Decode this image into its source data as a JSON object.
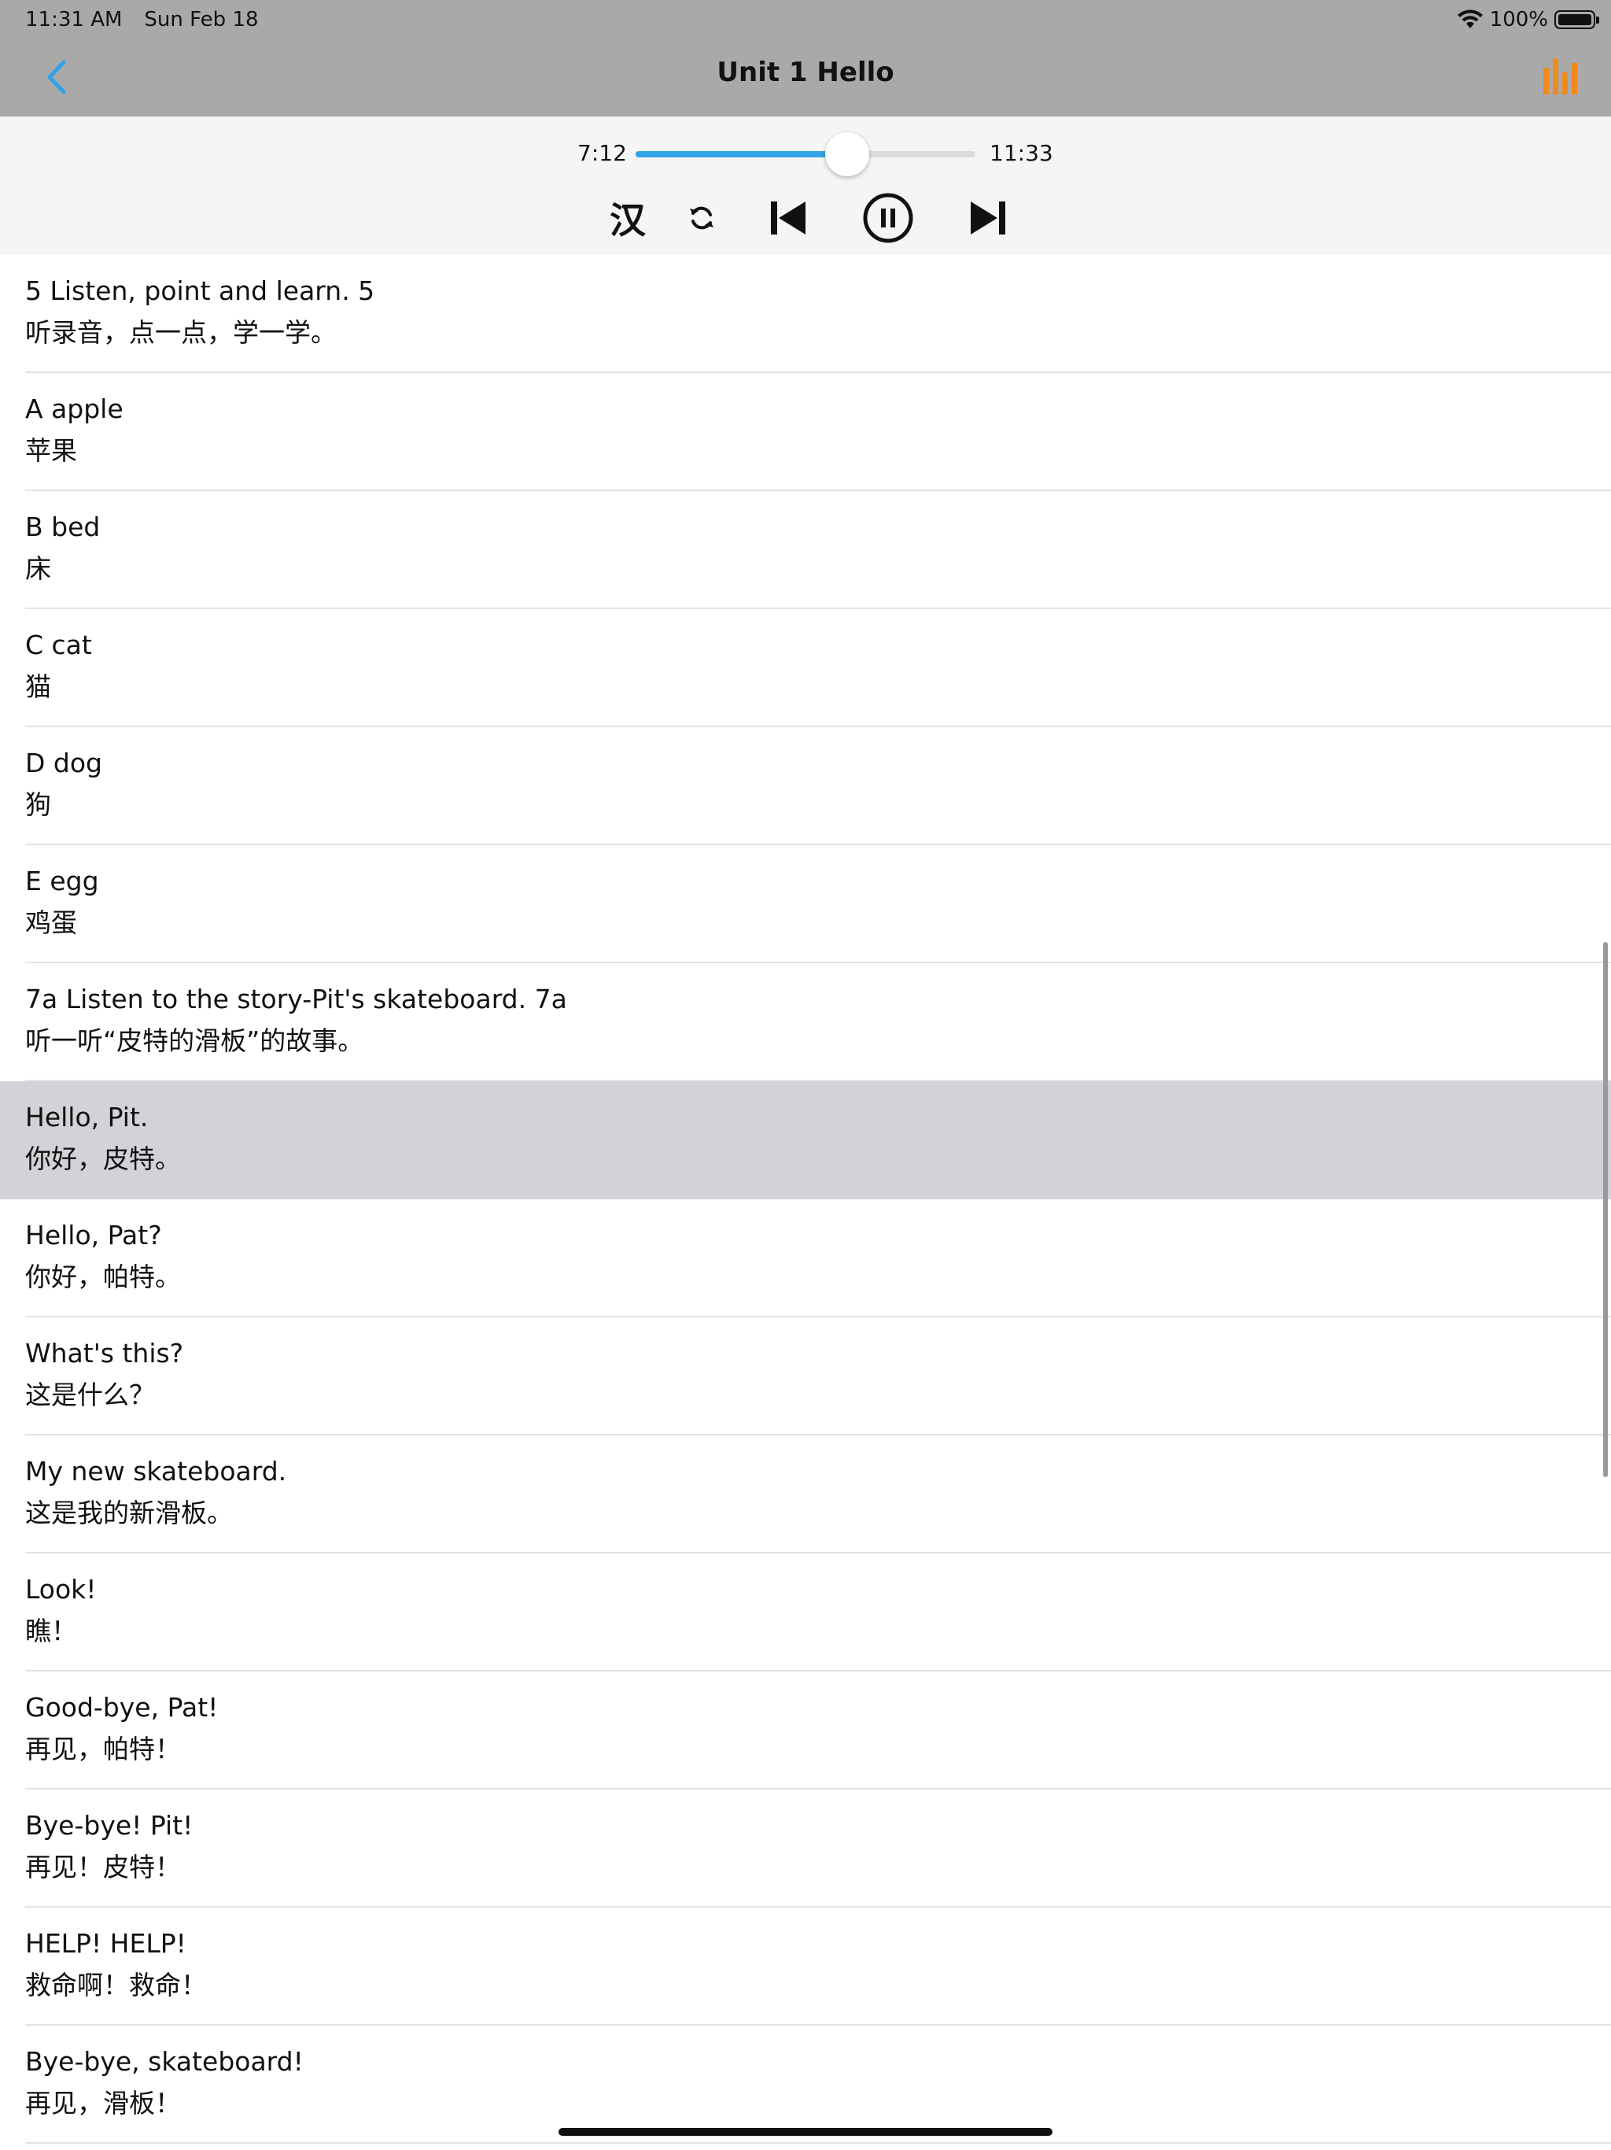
{
  "status_bar": {
    "time": "11:31 AM",
    "date": "Sun Feb 18",
    "battery_text": "100%",
    "battery_level": 1.0
  },
  "nav": {
    "title": "Unit 1 Hello",
    "back_icon": "chevron-left-icon",
    "stats_icon": "bar-chart-icon",
    "accent_color": "#2fa3e6",
    "stats_color": "#f08a1c"
  },
  "player": {
    "current_time": "7:12",
    "total_time": "11:33",
    "progress": 0.623,
    "lang_toggle_label": "汉",
    "repeat_icon": "repeat-icon",
    "prev_icon": "skip-previous-icon",
    "pause_icon": "pause-circle-icon",
    "next_icon": "skip-next-icon"
  },
  "list": {
    "active_index": 7,
    "items": [
      {
        "en": "5 Listen, point and learn. 5",
        "zh": "听录音，点一点，学一学。"
      },
      {
        "en": "A apple",
        "zh": "苹果"
      },
      {
        "en": "B bed",
        "zh": "床"
      },
      {
        "en": "C cat",
        "zh": "猫"
      },
      {
        "en": "D dog",
        "zh": "狗"
      },
      {
        "en": "E egg",
        "zh": "鸡蛋"
      },
      {
        "en": "7a Listen to the story-Pit's skateboard. 7a",
        "zh": "听一听“皮特的滑板”的故事。"
      },
      {
        "en": "Hello, Pit.",
        "zh": "你好，皮特。"
      },
      {
        "en": "Hello, Pat?",
        "zh": "你好，帕特。"
      },
      {
        "en": "What's this?",
        "zh": "这是什么？"
      },
      {
        "en": "My new skateboard.",
        "zh": "这是我的新滑板。"
      },
      {
        "en": "Look!",
        "zh": "瞧！"
      },
      {
        "en": "Good-bye, Pat!",
        "zh": "再见，帕特！"
      },
      {
        "en": "Bye-bye! Pit!",
        "zh": "再见！皮特！"
      },
      {
        "en": "HELP! HELP!",
        "zh": "救命啊！救命！"
      },
      {
        "en": "Bye-bye, skateboard!",
        "zh": "再见，滑板！"
      }
    ]
  }
}
